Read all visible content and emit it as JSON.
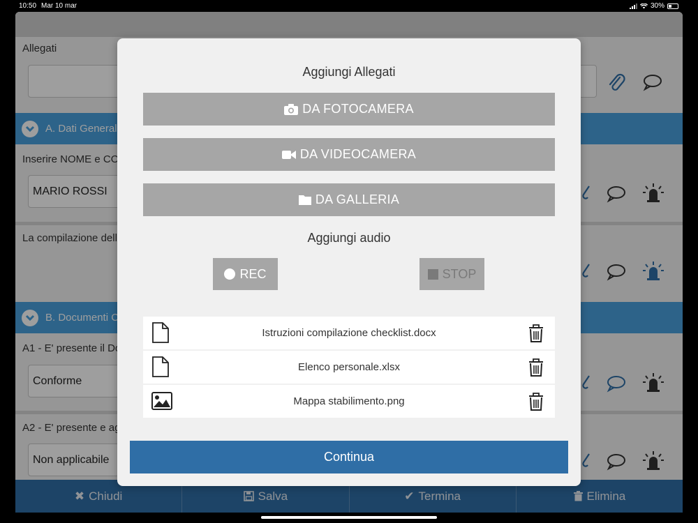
{
  "status": {
    "time": "10:50",
    "date": "Mar 10 mar",
    "battery": "30%"
  },
  "form": {
    "allegati_label": "Allegati",
    "section_a": "A. Dati General",
    "nome_label": "Inserire NOME e CO",
    "nome_value": "MARIO ROSSI",
    "compilazione_label": "La compilazione dell",
    "section_b": "B. Documenti C",
    "a1_label": "A1 - E' presente il Do",
    "a1_value": "Conforme",
    "a2_label": "A2 - E' presente e ag",
    "a2_value": "Non applicabile"
  },
  "modal": {
    "title": "Aggiungi Allegati",
    "btn_camera": "DA FOTOCAMERA",
    "btn_video": "DA VIDEOCAMERA",
    "btn_gallery": "DA GALLERIA",
    "audio_title": "Aggiungi audio",
    "rec": "REC",
    "stop": "STOP",
    "files": [
      {
        "name": "Istruzioni compilazione checklist.docx",
        "icon": "file-icon"
      },
      {
        "name": "Elenco personale.xlsx",
        "icon": "file-icon"
      },
      {
        "name": "Mappa stabilimento.png",
        "icon": "image-icon"
      }
    ],
    "continue": "Continua"
  },
  "bottombar": {
    "close": "Chiudi",
    "save": "Salva",
    "finish": "Termina",
    "delete": "Elimina"
  },
  "colors": {
    "accent": "#2f6ea6",
    "section": "#4aa0dd",
    "gray_button": "#a6a6a6"
  }
}
